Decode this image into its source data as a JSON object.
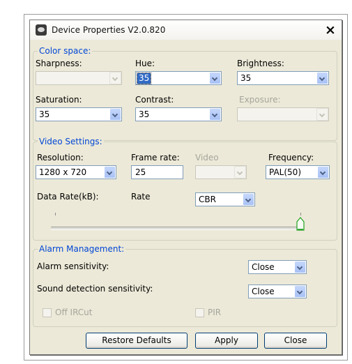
{
  "window": {
    "title": "Device Properties V2.0.820",
    "close_glyph": "×"
  },
  "color_space": {
    "legend": "Color space:",
    "sharpness": {
      "label": "Sharpness:",
      "value": ""
    },
    "hue": {
      "label": "Hue:",
      "value": "35"
    },
    "brightness": {
      "label": "Brightness:",
      "value": "35"
    },
    "saturation": {
      "label": "Saturation:",
      "value": "35"
    },
    "contrast": {
      "label": "Contrast:",
      "value": "35"
    },
    "exposure": {
      "label": "Exposure:",
      "value": ""
    }
  },
  "video_settings": {
    "legend": "Video Settings:",
    "resolution": {
      "label": "Resolution:",
      "value": "1280 x 720"
    },
    "frame_rate": {
      "label": "Frame rate:",
      "value": "25"
    },
    "video": {
      "label": "Video",
      "value": ""
    },
    "frequency": {
      "label": "Frequency:",
      "value": "PAL(50)"
    },
    "data_rate_label": "Data Rate(kB):",
    "rate": {
      "label": "Rate",
      "value": "CBR"
    },
    "slider_value": 1.0
  },
  "alarm": {
    "legend": "Alarm Management:",
    "alarm_sensitivity": {
      "label": "Alarm sensitivity:",
      "value": "Close"
    },
    "sound_sensitivity": {
      "label": "Sound detection sensitivity:",
      "value": "Close"
    },
    "off_ircut": {
      "label": "Off IRCut",
      "checked": false
    },
    "pir": {
      "label": "PIR",
      "checked": false
    }
  },
  "buttons": {
    "restore": "Restore Defaults",
    "apply": "Apply",
    "close": "Close"
  }
}
